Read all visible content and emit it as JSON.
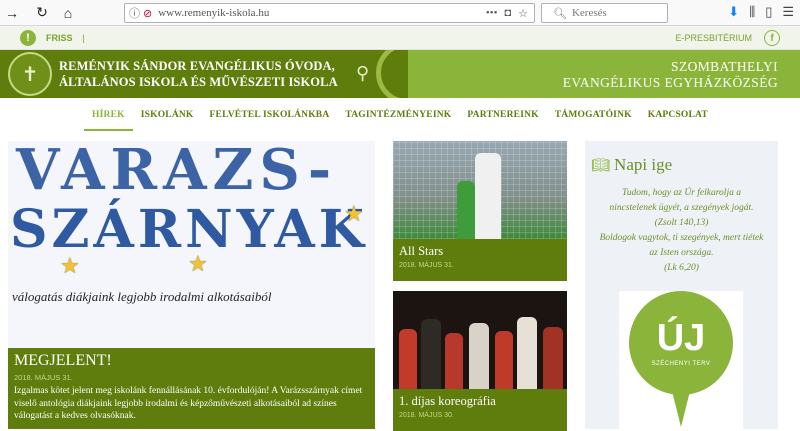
{
  "browser": {
    "url": "www.remenyik-iskola.hu",
    "search_placeholder": "Keresés",
    "more_dots": "•••"
  },
  "topstrip": {
    "friss_label": "FRISS",
    "separator": "|",
    "epresbiterium_label": "E-PRESBITÉRIUM"
  },
  "header": {
    "school_line1": "REMÉNYIK SÁNDOR EVANGÉLIKUS ÓVODA,",
    "school_line2": "ÁLTALÁNOS ISKOLA ÉS MŰVÉSZETI ISKOLA",
    "church_line1": "SZOMBATHELYI",
    "church_line2": "EVANGÉLIKUS EGYHÁZKÖZSÉG"
  },
  "menu": [
    {
      "label": "HÍREK",
      "active": true
    },
    {
      "label": "ISKOLÁNK"
    },
    {
      "label": "FELVÉTEL ISKOLÁNKBA"
    },
    {
      "label": "TAGINTÉZMÉNYEINK"
    },
    {
      "label": "PARTNEREINK"
    },
    {
      "label": "TÁMOGATÓINK"
    },
    {
      "label": "KAPCSOLAT"
    }
  ],
  "main_article": {
    "image_text1": "VARAZS-",
    "image_text2": "SZÁRNYAK",
    "image_text3": "válogatás diákjaink legjobb irodalmi alkotásaiból",
    "title": "MEGJELENT!",
    "date": "2018. MÁJUS 31.",
    "excerpt": "Izgalmas kötet jelent meg iskolánk fennállásának 10. évfordulóján! A Varázsszárnyak címet viselő antológia diákjaink legjobb irodalmi és képzőművészeti alkotásaiból ad színes válogatást a kedves olvasóknak."
  },
  "cards": [
    {
      "title": "All Stars",
      "date": "2018. MÁJUS 31."
    },
    {
      "title": "1. díjas koreográfia",
      "date": "2018. MÁJUS 30."
    }
  ],
  "sidebar": {
    "title": "Napi ige",
    "verse_lines": [
      "Tudom, hogy az Úr felkarolja a",
      "nincstelenek ügyét, a szegények jogát.",
      "(Zsolt 140,13)",
      "Boldogok vagytok, ti szegények, mert tiétek",
      "az Isten országa.",
      "(Lk 6,20)"
    ],
    "poster_big": "ÚJ",
    "poster_small": "SZÉCHENYI TERV"
  },
  "colors": {
    "dark_green": "#5e7d0c",
    "light_green": "#8ab53a"
  }
}
